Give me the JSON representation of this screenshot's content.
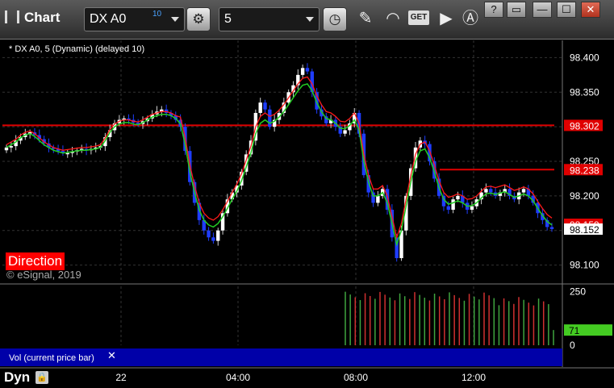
{
  "app": {
    "title": "Chart",
    "bottom_title": "Dyn"
  },
  "toolbar": {
    "symbol": "DX A0",
    "symbol_badge": "10",
    "interval": "5",
    "get_label": "GET",
    "window_buttons": [
      "?",
      "▭",
      "—",
      "☐",
      "✕"
    ]
  },
  "chart": {
    "sublabel": "* DX A0, 5 (Dynamic) (delayed 10)",
    "direction_label": "Direction",
    "copyright": "© eSignal, 2019",
    "vol_label": "Vol (current price bar)"
  },
  "chart_data": {
    "type": "candlestick",
    "price_axis": {
      "ticks": [
        98.4,
        98.35,
        98.3,
        98.25,
        98.2,
        98.15,
        98.1
      ],
      "tick_labels": [
        "98.400",
        "98.350",
        "98.250",
        "98.200",
        "98.100"
      ],
      "ylim": [
        98.075,
        98.425
      ]
    },
    "time_axis": {
      "tick_labels": [
        "22",
        "04:00",
        "08:00",
        "12:00"
      ]
    },
    "price_markers": [
      {
        "label": "98.302",
        "value": 98.302,
        "color": "#ff0000"
      },
      {
        "label": "98.238",
        "value": 98.238,
        "color": "#ff0000"
      },
      {
        "label": "98.152",
        "value": 98.152,
        "color": "#ffffff"
      },
      {
        "label": "98.159",
        "value": 98.159,
        "color": "#ff0000"
      }
    ],
    "closes": [
      98.27,
      98.272,
      98.28,
      98.285,
      98.29,
      98.292,
      98.288,
      98.282,
      98.276,
      98.27,
      98.268,
      98.265,
      98.262,
      98.262,
      98.264,
      98.266,
      98.268,
      98.266,
      98.268,
      98.27,
      98.272,
      98.285,
      98.295,
      98.305,
      98.31,
      98.312,
      98.31,
      98.306,
      98.304,
      98.308,
      98.312,
      98.318,
      98.322,
      98.325,
      98.32,
      98.316,
      98.31,
      98.3,
      98.265,
      98.22,
      98.19,
      98.165,
      98.15,
      98.14,
      98.135,
      98.15,
      98.175,
      98.195,
      98.205,
      98.215,
      98.235,
      98.26,
      98.28,
      98.32,
      98.335,
      98.325,
      98.3,
      98.31,
      98.32,
      98.335,
      98.35,
      98.36,
      98.375,
      98.385,
      98.38,
      98.35,
      98.325,
      98.315,
      98.305,
      98.31,
      98.3,
      98.29,
      98.295,
      98.305,
      98.32,
      98.29,
      98.23,
      98.205,
      98.19,
      98.2,
      98.21,
      98.18,
      98.14,
      98.11,
      98.15,
      98.2,
      98.24,
      98.27,
      98.28,
      98.275,
      98.25,
      98.225,
      98.2,
      98.185,
      98.18,
      98.195,
      98.2,
      98.19,
      98.18,
      98.185,
      98.195,
      98.205,
      98.21,
      98.205,
      98.2,
      98.205,
      98.21,
      98.2,
      98.195,
      98.205,
      98.21,
      98.2,
      98.19,
      98.175,
      98.165,
      98.155,
      98.152
    ],
    "green_line": [
      98.27,
      98.274,
      98.278,
      98.284,
      98.288,
      98.29,
      98.286,
      98.28,
      98.274,
      98.27,
      98.266,
      98.264,
      98.262,
      98.263,
      98.264,
      98.265,
      98.266,
      98.266,
      98.267,
      98.268,
      98.27,
      98.28,
      98.292,
      98.3,
      98.304,
      98.306,
      98.306,
      98.304,
      98.303,
      98.306,
      98.31,
      98.314,
      98.316,
      98.318,
      98.318,
      98.316,
      98.312,
      98.304,
      98.275,
      98.235,
      98.205,
      98.18,
      98.165,
      98.158,
      98.155,
      98.16,
      98.17,
      98.182,
      98.195,
      98.207,
      98.222,
      98.242,
      98.262,
      98.29,
      98.305,
      98.31,
      98.305,
      98.308,
      98.314,
      98.322,
      98.332,
      98.342,
      98.352,
      98.36,
      98.362,
      98.352,
      98.335,
      98.322,
      98.312,
      98.31,
      98.305,
      98.298,
      98.297,
      98.302,
      98.31,
      98.295,
      98.25,
      98.22,
      98.2,
      98.2,
      98.205,
      98.19,
      98.16,
      98.13,
      98.15,
      98.185,
      98.22,
      98.25,
      98.265,
      98.268,
      98.255,
      98.235,
      98.212,
      98.195,
      98.188,
      98.19,
      98.193,
      98.19,
      98.185,
      98.186,
      98.19,
      98.197,
      98.203,
      98.204,
      98.202,
      98.204,
      98.206,
      98.202,
      98.198,
      98.2,
      98.203,
      98.2,
      98.193,
      98.182,
      98.172,
      98.163,
      98.158
    ],
    "volume_axis": {
      "ticks": [
        250,
        0
      ],
      "marker": 71
    },
    "volume_bars_count": 43
  },
  "colors": {
    "up": "#ffffff",
    "down": "#1f3dff",
    "green": "#22cc22",
    "red": "#ff1a1a",
    "vol_up": "#3fa53f",
    "vol_down": "#d03030",
    "panel_blue": "#0000a8"
  }
}
